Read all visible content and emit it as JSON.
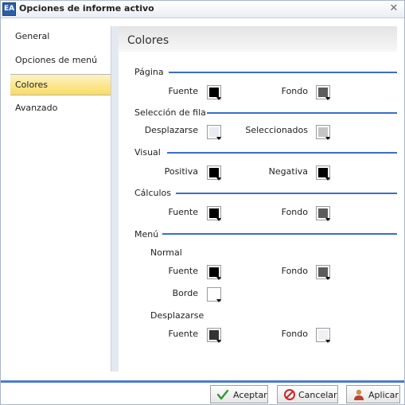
{
  "window": {
    "icon_text": "EA",
    "title": "Opciones de informe activo"
  },
  "sidebar": {
    "items": [
      {
        "label": "General",
        "active": false
      },
      {
        "label": "Opciones de menú",
        "active": false
      },
      {
        "label": "Colores",
        "active": true
      },
      {
        "label": "Avanzado",
        "active": false
      }
    ]
  },
  "panel": {
    "title": "Colores",
    "pagina": {
      "label": "Página",
      "fuente": {
        "label": "Fuente",
        "color": "#000000"
      },
      "fondo": {
        "label": "Fondo",
        "color": "#5c5c5c"
      }
    },
    "seleccion": {
      "label": "Selección de fila",
      "desplazarse": {
        "label": "Desplazarse",
        "color": "#e8ecf2"
      },
      "seleccionados": {
        "label": "Seleccionados",
        "color": "#c4c4c4"
      }
    },
    "visual": {
      "label": "Visual",
      "positiva": {
        "label": "Positiva",
        "color": "#000000"
      },
      "negativa": {
        "label": "Negativa",
        "color": "#000000"
      }
    },
    "calculos": {
      "label": "Cálculos",
      "fuente": {
        "label": "Fuente",
        "color": "#000000"
      },
      "fondo": {
        "label": "Fondo",
        "color": "#5c5c5c"
      }
    },
    "menu": {
      "label": "Menú",
      "normal": {
        "label": "Normal",
        "fuente": {
          "label": "Fuente",
          "color": "#000000"
        },
        "fondo": {
          "label": "Fondo",
          "color": "#5c5c5c"
        },
        "borde": {
          "label": "Borde",
          "color": "#ffffff"
        }
      },
      "desplazarse": {
        "label": "Desplazarse",
        "fuente": {
          "label": "Fuente",
          "color": "#333333"
        },
        "fondo": {
          "label": "Fondo",
          "color": "#eef0f4"
        }
      }
    }
  },
  "footer": {
    "aceptar": "Aceptar",
    "cancelar": "Cancelar",
    "aplicar": "Aplicar"
  },
  "colors": {
    "accent_line": "#3c6dc5",
    "active_nav": "#f9dc63"
  }
}
